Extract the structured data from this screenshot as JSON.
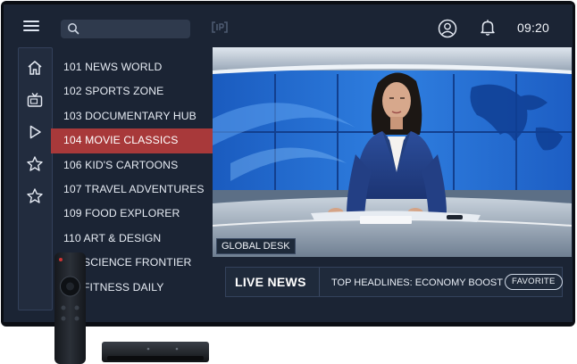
{
  "header": {
    "search": {
      "placeholder": "",
      "value": ""
    },
    "clock": "09:20"
  },
  "sidebar": {
    "icons": [
      "home-icon",
      "tv-icon",
      "play-icon",
      "star-icon",
      "star-icon"
    ]
  },
  "channels": [
    {
      "label": "101 NEWS WORLD"
    },
    {
      "label": "102 SPORTS ZONE"
    },
    {
      "label": "103 DOCUMENTARY HUB"
    },
    {
      "label": "104 MOVIE CLASSICS",
      "active": true
    },
    {
      "label": "106 KID'S CARTOONS"
    },
    {
      "label": "107 TRAVEL ADVENTURES"
    },
    {
      "label": "109 FOOD EXPLORER"
    },
    {
      "label": "110 ART & DESIGN"
    },
    {
      "label": "SCIENCE FRONTIER"
    },
    {
      "label": "FITNESS DAILY"
    }
  ],
  "player": {
    "overlay_tag": "GLOBAL DESK"
  },
  "newsbar": {
    "title": "LIVE NEWS",
    "headline": "TOP HEADLINES: ECONOMY BOOST",
    "favorite_label": "FAVORITE"
  },
  "colors": {
    "screen_bg": "#1b2434",
    "active_channel": "#a8393a",
    "accent_blue": "#2a6fd0"
  }
}
